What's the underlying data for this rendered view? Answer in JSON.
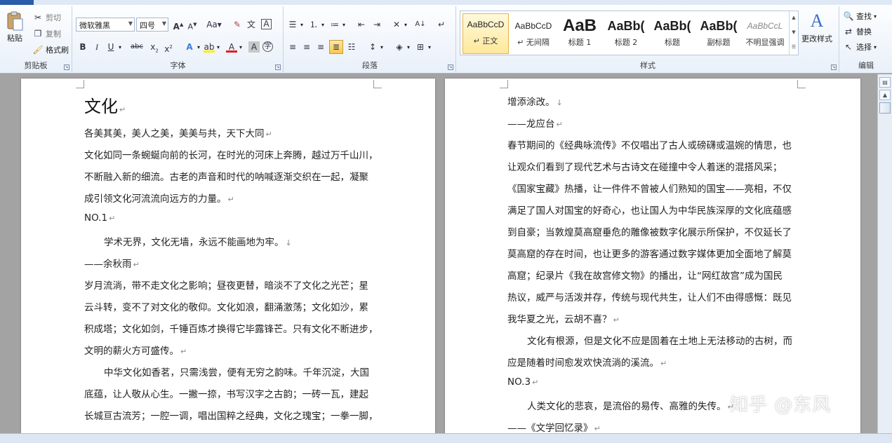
{
  "ribbon": {
    "clipboard": {
      "label": "剪贴板",
      "paste": "粘贴",
      "cut": "剪切",
      "copy": "复制",
      "format_painter": "格式刷"
    },
    "font": {
      "label": "字体",
      "font_name": "微软雅黑",
      "font_size": "四号"
    },
    "paragraph": {
      "label": "段落"
    },
    "styles": {
      "label": "样式",
      "items": [
        {
          "sample": "AaBbCcD",
          "name": "↵ 正文"
        },
        {
          "sample": "AaBbCcD",
          "name": "↵ 无间隔"
        },
        {
          "sample": "AaB",
          "name": "标题 1"
        },
        {
          "sample": "AaBb(",
          "name": "标题 2"
        },
        {
          "sample": "AaBb(",
          "name": "标题"
        },
        {
          "sample": "AaBb(",
          "name": "副标题"
        },
        {
          "sample": "AaBbCcL",
          "name": "不明显强调"
        }
      ],
      "change_styles": "更改样式"
    },
    "editing": {
      "label": "编辑",
      "find": "查找",
      "replace": "替换",
      "select": "选择"
    }
  },
  "page1": {
    "title": "文化",
    "lines": [
      "各美其美，美人之美，美美与共，天下大同",
      "文化如同一条蜿蜒向前的长河，在时光的河床上奔腾，越过万千山川，",
      "不断融入新的细流。古老的声音和时代的呐喊逐渐交织在一起，凝聚",
      "成引领文化河流流向远方的力量。",
      "NO.1",
      "学术无界，文化无墙，永远不能画地为牢。",
      "——余秋雨",
      "岁月流淌，带不走文化之影响；昼夜更替，暗淡不了文化之光芒；星",
      "云斗转，变不了对文化的敬仰。文化如浪，翻涌激荡；文化如沙，累",
      "积成塔；文化如剑，千锤百炼才换得它毕露锋芒。只有文化不断进步，",
      "文明的薪火方可盛传。",
      "中华文化如香茗，只需浅尝，便有无穷之韵味。千年沉淀，大国",
      "底蕴，让人敬从心生。一撇一捺，书写汉字之古韵；一砖一瓦，建起",
      "长城亘古流芳；一腔一调，唱出国粹之经典，文化之瑰宝；一拳一脚，"
    ]
  },
  "page2": {
    "lines": [
      "增添涂改。",
      "——龙应台",
      "春节期间的《经典咏流传》不仅唱出了古人或磅礴或温婉的情思，也",
      "让观众们看到了现代艺术与古诗文在碰撞中令人着迷的混搭风采；",
      "《国家宝藏》热播，让一件件不曾被人们熟知的国宝——亮相，不仅",
      "满足了国人对国宝的好奇心，也让国人为中华民族深厚的文化底蕴感",
      "到自豪；当敦煌莫高窟垂危的雕像被数字化展示所保护，不仅延长了",
      "莫高窟的存在时间，也让更多的游客通过数字媒体更加全面地了解莫",
      "高窟；纪录片《我在故宫修文物》的播出，让“网红故宫”成为国民",
      "热议，威严与活泼并存，传统与现代共生，让人们不由得感慨：既见",
      "我华夏之光，云胡不喜？",
      "文化有根源，但是文化不应是固着在土地上无法移动的古树，而",
      "应是随着时间愈发欢快流淌的溪流。",
      "NO.3",
      "人类文化的悲哀，是流俗的易传、高雅的失传。",
      "——《文学回忆录》"
    ]
  },
  "watermark": "知乎 @东风"
}
